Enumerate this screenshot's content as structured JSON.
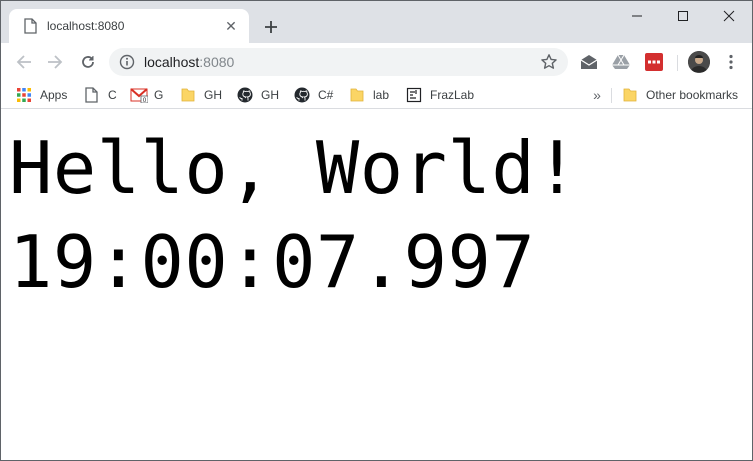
{
  "tab": {
    "title": "localhost:8080",
    "close_glyph": "✕",
    "icon": "page-icon"
  },
  "new_tab_icon": "plus-icon",
  "window_controls": [
    "minimize-icon",
    "maximize-icon",
    "close-icon"
  ],
  "toolbar": {
    "back_icon": "arrow-left-icon",
    "forward_icon": "arrow-right-icon",
    "reload_icon": "reload-icon",
    "url_host": "localhost",
    "url_port": ":8080",
    "info_icon": "info-icon",
    "bookmark_star_icon": "star-icon",
    "extensions": [
      "mail-extension-icon",
      "drive-extension-icon",
      "red-extension-icon"
    ],
    "menu_icon": "kebab-menu-icon"
  },
  "bookmarks": {
    "items": [
      {
        "label": "Apps",
        "icon": "apps-grid-icon"
      },
      {
        "label": "C",
        "icon": "page-icon"
      },
      {
        "label": "G",
        "icon": "gmail-icon"
      },
      {
        "label": "GH",
        "icon": "folder-icon"
      },
      {
        "label": "GH",
        "icon": "github-icon"
      },
      {
        "label": "C#",
        "icon": "github-icon"
      },
      {
        "label": "lab",
        "icon": "folder-icon"
      },
      {
        "label": "FrazLab",
        "icon": "frazlab-icon"
      }
    ],
    "more_glyph": "»",
    "other": {
      "label": "Other bookmarks",
      "icon": "folder-icon"
    }
  },
  "content": {
    "greeting": "Hello, World!",
    "time": "19:00:07.997"
  },
  "colors": {
    "tabstrip": "#dee1e6",
    "omnibox": "#f1f3f4",
    "folder": "#fbd565",
    "github": "#24292e",
    "gmail_red": "#d93025",
    "ext_red": "#d32f2f"
  }
}
